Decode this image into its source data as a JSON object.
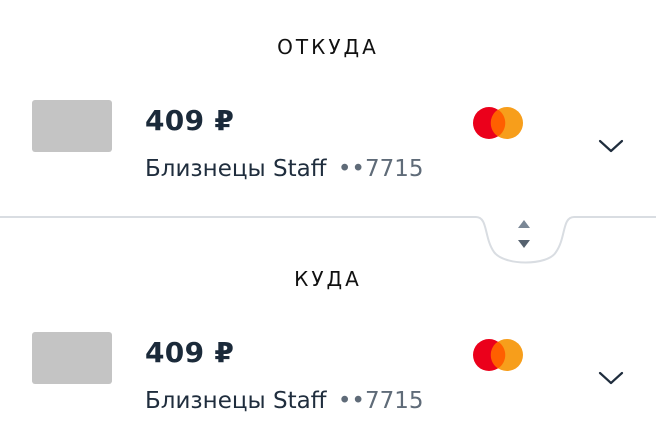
{
  "from": {
    "title": "ОТКУДА",
    "amount": "409 ₽",
    "card_name": "Близнецы Staff",
    "card_number": "••7715",
    "payment_system_icon": "mastercard-logo"
  },
  "to": {
    "title": "КУДА",
    "amount": "409 ₽",
    "card_name": "Близнецы Staff",
    "card_number": "••7715",
    "payment_system_icon": "mastercard-logo"
  },
  "icons": {
    "expand": "chevron-down-icon",
    "swap": "swap-arrows-icon"
  },
  "colors": {
    "mastercard_red": "#eb001b",
    "mastercard_orange": "#f79e1b",
    "card_placeholder": "#c4c4c4",
    "divider": "#d9dde2",
    "muted_text": "#5f6b78"
  }
}
